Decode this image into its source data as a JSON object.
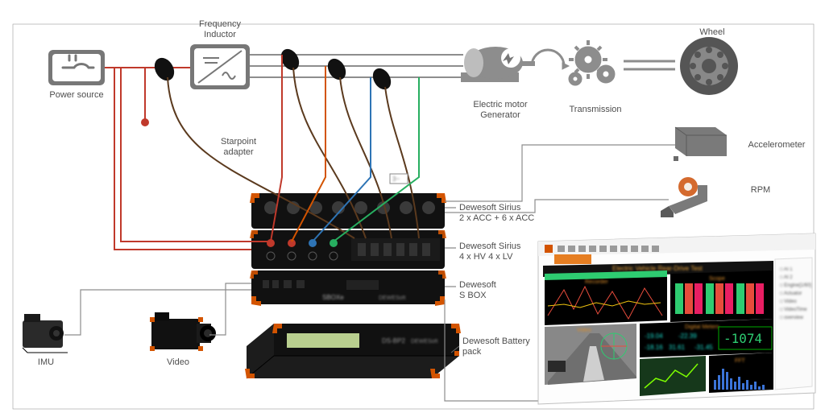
{
  "labels": {
    "power_source": "Power source",
    "frequency_inductor": "Frequency\nInductor",
    "starpoint_adapter": "Starpoint\nadapter",
    "electric_motor": "Electric motor\nGenerator",
    "transmission": "Transmission",
    "wheel": "Wheel",
    "accelerometer": "Accelerometer",
    "rpm": "RPM",
    "sirius_acc": "Dewesoft Sirius\n2 x ACC + 6 x ACC",
    "sirius_hv": "Dewesoft Sirius\n4 x HV 4 x LV",
    "sbox": "Dewesoft\nS BOX",
    "battery": "Dewesoft Battery\npack",
    "imu": "IMU",
    "video": "Video",
    "devices": {
      "sboxe": "SBOXe",
      "brand": "DEWESoft",
      "battery_model": "DS-BP2"
    }
  },
  "software": {
    "title": "Electric Vehicle Rear-Drive Test",
    "panels": {
      "left": "Recorder",
      "right": "Scope",
      "video": "Video",
      "meters": "Digital Meters"
    },
    "meter_value": "-1074",
    "meter_aux_a": "-19.04",
    "meter_aux_b": "-22.39",
    "meter_aux_c": "-18.16",
    "meter_aux_d": "31.61",
    "meter_aux_e": "-31.45",
    "fft": "FFT",
    "channels": [
      "AI 1",
      "AI 2",
      "Engine[1/60]",
      "Actuator lead/lean",
      "Video",
      "VideoTime",
      "overview"
    ]
  }
}
